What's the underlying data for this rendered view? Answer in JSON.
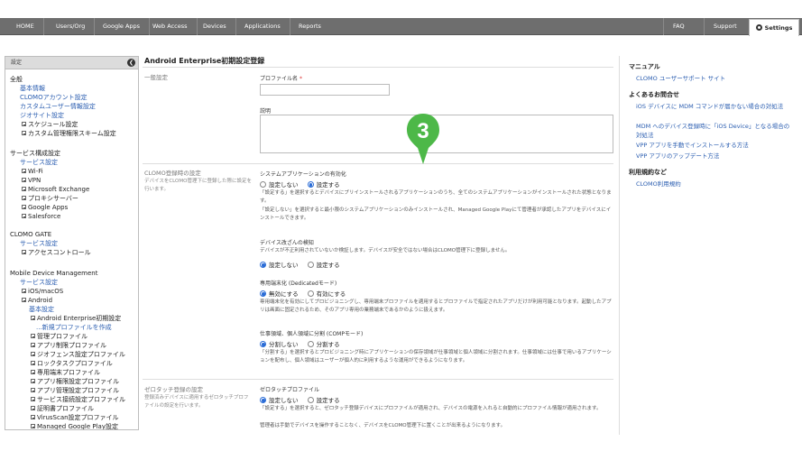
{
  "topnav": {
    "items": [
      "HOME",
      "Users/Org",
      "Google Apps",
      "Web Access",
      "Devices",
      "Applications",
      "Reports"
    ],
    "right_items": [
      "FAQ",
      "Support"
    ],
    "settings_label": "Settings"
  },
  "sidebar": {
    "header": "設定",
    "groups": [
      {
        "title": "全般",
        "items": [
          {
            "label": "基本情報",
            "type": "link"
          },
          {
            "label": "CLOMOアカウント設定",
            "type": "link"
          },
          {
            "label": "カスタムユーザー情報設定",
            "type": "link"
          },
          {
            "label": "ジオサイト設定",
            "type": "link"
          },
          {
            "label": "スケジュール設定",
            "type": "tree"
          },
          {
            "label": "カスタム管理権限スキーム設定",
            "type": "tree"
          }
        ]
      },
      {
        "title": "サービス構成設定",
        "items": [
          {
            "label": "サービス設定",
            "type": "link"
          },
          {
            "label": "Wi-Fi",
            "type": "tree"
          },
          {
            "label": "VPN",
            "type": "tree"
          },
          {
            "label": "Microsoft Exchange",
            "type": "tree"
          },
          {
            "label": "プロキシサーバー",
            "type": "tree"
          },
          {
            "label": "Google Apps",
            "type": "tree"
          },
          {
            "label": "Salesforce",
            "type": "tree"
          }
        ]
      },
      {
        "title": "CLOMO GATE",
        "items": [
          {
            "label": "サービス設定",
            "type": "link"
          },
          {
            "label": "アクセスコントロール",
            "type": "tree"
          }
        ]
      },
      {
        "title": "Mobile Device Management",
        "items": [
          {
            "label": "サービス設定",
            "type": "link"
          },
          {
            "label": "iOS/macOS",
            "type": "tree"
          },
          {
            "label": "Android",
            "type": "tree"
          },
          {
            "label": "基本設定",
            "type": "link"
          },
          {
            "label": "Android Enterprise初期設定",
            "type": "tree"
          },
          {
            "label": "...新規プロファイルを作成",
            "type": "link"
          },
          {
            "label": "管理プロファイル",
            "type": "tree"
          },
          {
            "label": "アプリ制限プロファイル",
            "type": "tree"
          },
          {
            "label": "ジオフェンス設定プロファイル",
            "type": "tree"
          },
          {
            "label": "ロックタスクプロファイル",
            "type": "tree"
          },
          {
            "label": "専用端末プロファイル",
            "type": "tree"
          },
          {
            "label": "アプリ権限設定プロファイル",
            "type": "tree"
          },
          {
            "label": "アプリ管理設定プロファイル",
            "type": "tree"
          },
          {
            "label": "サービス接続設定プロファイル",
            "type": "tree"
          },
          {
            "label": "証明書プロファイル",
            "type": "tree"
          },
          {
            "label": "VirusScan設定プロファイル",
            "type": "tree"
          },
          {
            "label": "Managed Google Play設定",
            "type": "tree"
          }
        ]
      }
    ]
  },
  "main": {
    "title": "Android Enterprise初期設定登録",
    "general": {
      "label": "一般設定",
      "profile_name_label": "プロファイル名",
      "required_mark": "*",
      "description_label": "説明"
    },
    "clomo_settings": {
      "label": "CLOMO登録時の設定",
      "desc": "デバイスをCLOMO管理下に登録した際に設定を行います。",
      "system_apps": {
        "label": "システムアプリケーションの有効化",
        "options": [
          "設定しない",
          "設定する"
        ],
        "selected": 1,
        "help1": "「設定する」を選択するとデバイスにプリインストールされるアプリケーションのうち、全てのシステムアプリケーションがインストールされた状態となります。",
        "help2": "「設定しない」を選択すると最小限のシステムアプリケーションのみインストールされ、Managed Google Playにて管理者が承認したアプリをデバイスにインストールできます。"
      },
      "tamper": {
        "label": "デバイス改ざんの検知",
        "help": "デバイスが不正利用されていないか検証します。デバイスが安全ではない場合はCLOMO管理下に登録しません。",
        "options": [
          "設定しない",
          "設定する"
        ],
        "selected": 0
      },
      "dedicated": {
        "label": "専用端末化 (Dedicatedモード)",
        "options": [
          "無効にする",
          "有効にする"
        ],
        "selected": 0,
        "help": "専用端末化を有効にしてプロビジョニングし、専用端末プロファイルを適用するとプロファイルで指定されたアプリだけが利用可能となります。起動したアプリは画面に固定されるため、そのアプリ専用の業務端末であるかのように扱えます。"
      },
      "comp": {
        "label": "仕事領域、個人領域に分割 (COMPモード)",
        "options": [
          "分割しない",
          "分割する"
        ],
        "selected": 0,
        "help": "「分割する」を選択するとプロビジョニング時にアプリケーションの保存領域が仕事領域と個人領域に分割されます。仕事領域には仕事で用いるアプリケーションを配布し、個人領域はユーザーが個人的に利用するような運用ができるようになります。"
      }
    },
    "zero_touch": {
      "label": "ゼロタッチ登録の設定",
      "desc": "登録済みデバイスに適用するゼロタッチプロファイルの設定を行います。",
      "profile": {
        "label": "ゼロタッチプロファイル",
        "options": [
          "設定しない",
          "設定する"
        ],
        "selected": 0,
        "help1": "「設定する」を選択すると、ゼロタッチ登録デバイスにプロファイルが適用され、デバイスの電源を入れると自動的にプロファイル情報が適用されます。",
        "help2": "管理者は手動でデバイスを操作することなく、デバイスをCLOMO管理下に置くことが出来るようになります。"
      }
    },
    "step_badge": "3",
    "badge_color": "#4db848"
  },
  "right_panel": {
    "manual": {
      "title": "マニュアル",
      "links": [
        "CLOMO ユーザーサポート サイト"
      ]
    },
    "faq": {
      "title": "よくあるお問合せ",
      "links": [
        "iOS デバイスに MDM コマンドが届かない場合の対処法",
        "MDM へのデバイス登録時に「iOS Device」となる場合の対処法",
        "VPP アプリを手動でインストールする方法",
        "VPP アプリのアップデート方法"
      ]
    },
    "terms": {
      "title": "利用規約など",
      "links": [
        "CLOMO利用規約"
      ]
    }
  }
}
